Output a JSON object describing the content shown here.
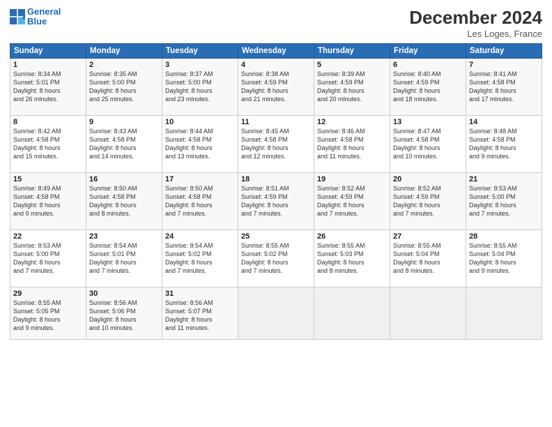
{
  "header": {
    "logo_line1": "General",
    "logo_line2": "Blue",
    "month_year": "December 2024",
    "location": "Les Loges, France"
  },
  "weekdays": [
    "Sunday",
    "Monday",
    "Tuesday",
    "Wednesday",
    "Thursday",
    "Friday",
    "Saturday"
  ],
  "weeks": [
    [
      {
        "day": "1",
        "info": "Sunrise: 8:34 AM\nSunset: 5:01 PM\nDaylight: 8 hours\nand 26 minutes."
      },
      {
        "day": "2",
        "info": "Sunrise: 8:35 AM\nSunset: 5:00 PM\nDaylight: 8 hours\nand 25 minutes."
      },
      {
        "day": "3",
        "info": "Sunrise: 8:37 AM\nSunset: 5:00 PM\nDaylight: 8 hours\nand 23 minutes."
      },
      {
        "day": "4",
        "info": "Sunrise: 8:38 AM\nSunset: 4:59 PM\nDaylight: 8 hours\nand 21 minutes."
      },
      {
        "day": "5",
        "info": "Sunrise: 8:39 AM\nSunset: 4:59 PM\nDaylight: 8 hours\nand 20 minutes."
      },
      {
        "day": "6",
        "info": "Sunrise: 8:40 AM\nSunset: 4:59 PM\nDaylight: 8 hours\nand 18 minutes."
      },
      {
        "day": "7",
        "info": "Sunrise: 8:41 AM\nSunset: 4:58 PM\nDaylight: 8 hours\nand 17 minutes."
      }
    ],
    [
      {
        "day": "8",
        "info": "Sunrise: 8:42 AM\nSunset: 4:58 PM\nDaylight: 8 hours\nand 15 minutes."
      },
      {
        "day": "9",
        "info": "Sunrise: 8:43 AM\nSunset: 4:58 PM\nDaylight: 8 hours\nand 14 minutes."
      },
      {
        "day": "10",
        "info": "Sunrise: 8:44 AM\nSunset: 4:58 PM\nDaylight: 8 hours\nand 13 minutes."
      },
      {
        "day": "11",
        "info": "Sunrise: 8:45 AM\nSunset: 4:58 PM\nDaylight: 8 hours\nand 12 minutes."
      },
      {
        "day": "12",
        "info": "Sunrise: 8:46 AM\nSunset: 4:58 PM\nDaylight: 8 hours\nand 11 minutes."
      },
      {
        "day": "13",
        "info": "Sunrise: 8:47 AM\nSunset: 4:58 PM\nDaylight: 8 hours\nand 10 minutes."
      },
      {
        "day": "14",
        "info": "Sunrise: 8:48 AM\nSunset: 4:58 PM\nDaylight: 8 hours\nand 9 minutes."
      }
    ],
    [
      {
        "day": "15",
        "info": "Sunrise: 8:49 AM\nSunset: 4:58 PM\nDaylight: 8 hours\nand 9 minutes."
      },
      {
        "day": "16",
        "info": "Sunrise: 8:50 AM\nSunset: 4:58 PM\nDaylight: 8 hours\nand 8 minutes."
      },
      {
        "day": "17",
        "info": "Sunrise: 8:50 AM\nSunset: 4:58 PM\nDaylight: 8 hours\nand 7 minutes."
      },
      {
        "day": "18",
        "info": "Sunrise: 8:51 AM\nSunset: 4:59 PM\nDaylight: 8 hours\nand 7 minutes."
      },
      {
        "day": "19",
        "info": "Sunrise: 8:52 AM\nSunset: 4:59 PM\nDaylight: 8 hours\nand 7 minutes."
      },
      {
        "day": "20",
        "info": "Sunrise: 8:52 AM\nSunset: 4:59 PM\nDaylight: 8 hours\nand 7 minutes."
      },
      {
        "day": "21",
        "info": "Sunrise: 8:53 AM\nSunset: 5:00 PM\nDaylight: 8 hours\nand 7 minutes."
      }
    ],
    [
      {
        "day": "22",
        "info": "Sunrise: 8:53 AM\nSunset: 5:00 PM\nDaylight: 8 hours\nand 7 minutes."
      },
      {
        "day": "23",
        "info": "Sunrise: 8:54 AM\nSunset: 5:01 PM\nDaylight: 8 hours\nand 7 minutes."
      },
      {
        "day": "24",
        "info": "Sunrise: 8:54 AM\nSunset: 5:02 PM\nDaylight: 8 hours\nand 7 minutes."
      },
      {
        "day": "25",
        "info": "Sunrise: 8:55 AM\nSunset: 5:02 PM\nDaylight: 8 hours\nand 7 minutes."
      },
      {
        "day": "26",
        "info": "Sunrise: 8:55 AM\nSunset: 5:03 PM\nDaylight: 8 hours\nand 8 minutes."
      },
      {
        "day": "27",
        "info": "Sunrise: 8:55 AM\nSunset: 5:04 PM\nDaylight: 8 hours\nand 8 minutes."
      },
      {
        "day": "28",
        "info": "Sunrise: 8:55 AM\nSunset: 5:04 PM\nDaylight: 8 hours\nand 9 minutes."
      }
    ],
    [
      {
        "day": "29",
        "info": "Sunrise: 8:55 AM\nSunset: 5:05 PM\nDaylight: 8 hours\nand 9 minutes."
      },
      {
        "day": "30",
        "info": "Sunrise: 8:56 AM\nSunset: 5:06 PM\nDaylight: 8 hours\nand 10 minutes."
      },
      {
        "day": "31",
        "info": "Sunrise: 8:56 AM\nSunset: 5:07 PM\nDaylight: 8 hours\nand 11 minutes."
      },
      null,
      null,
      null,
      null
    ]
  ]
}
